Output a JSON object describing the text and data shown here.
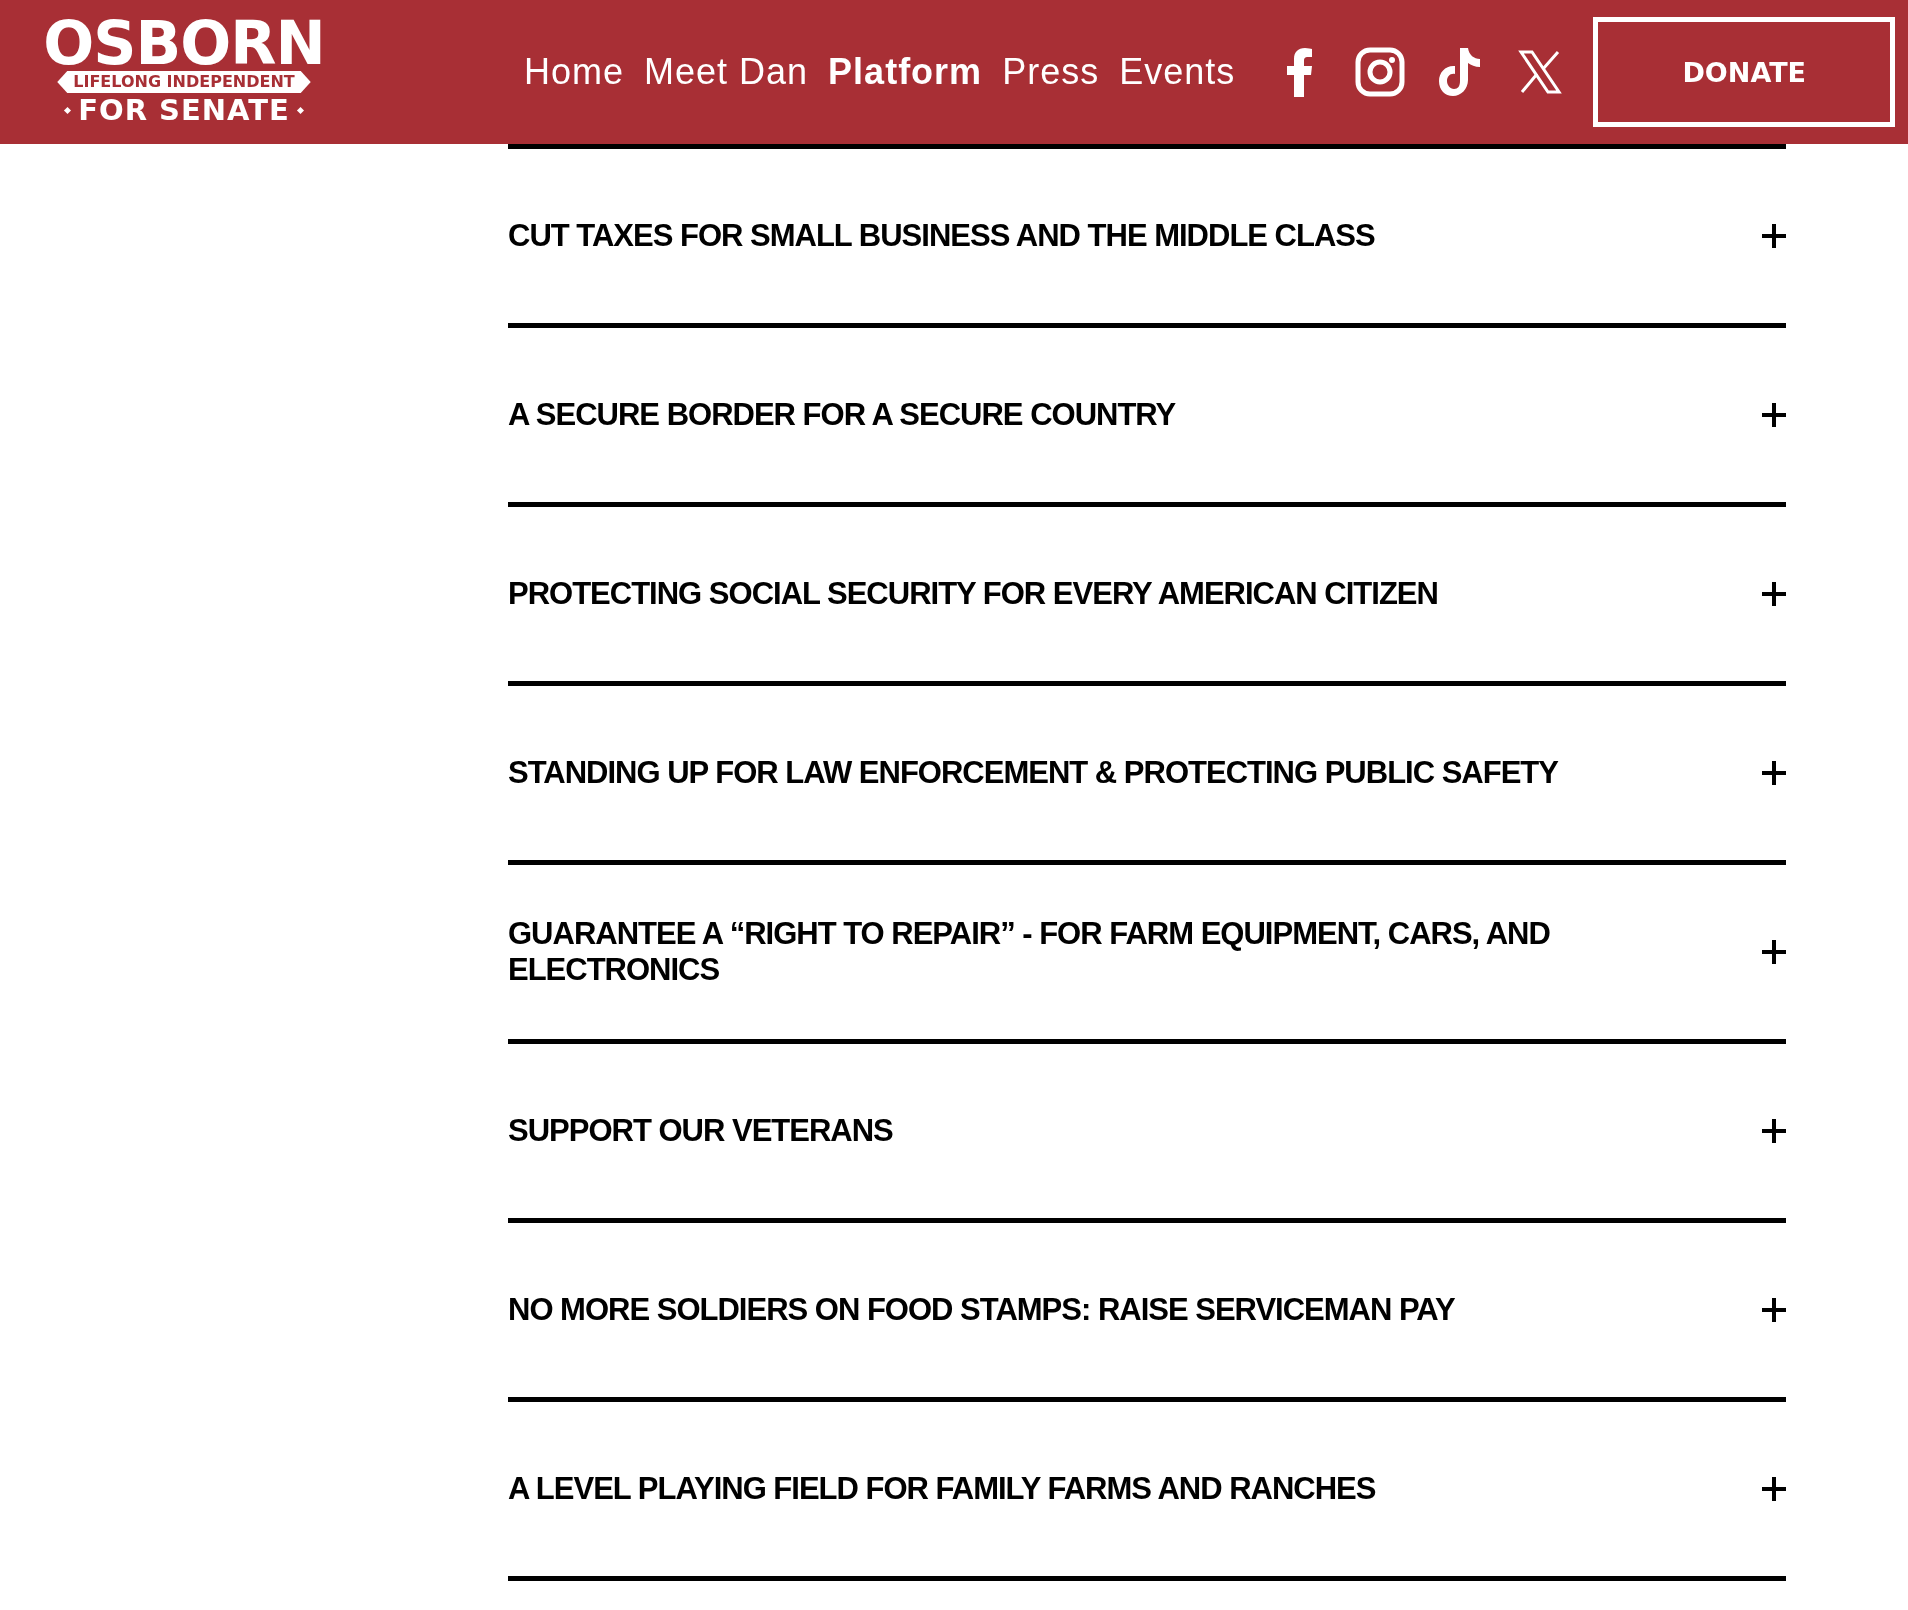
{
  "logo": {
    "name": "OSBORN",
    "tagline": "LIFELONG INDEPENDENT",
    "office": "FOR SENATE"
  },
  "nav": [
    {
      "label": "Home",
      "selected": false
    },
    {
      "label": "Meet Dan",
      "selected": false
    },
    {
      "label": "Platform",
      "selected": true
    },
    {
      "label": "Press",
      "selected": false
    },
    {
      "label": "Events",
      "selected": false
    }
  ],
  "social": [
    {
      "kind": "facebook"
    },
    {
      "kind": "instagram"
    },
    {
      "kind": "tiktok"
    },
    {
      "kind": "x"
    }
  ],
  "donate_button": "DONATE",
  "platform": [
    {
      "title": "CUT TAXES FOR SMALL BUSINESS AND THE MIDDLE CLASS",
      "expanded": false
    },
    {
      "title": "A SECURE BORDER FOR A SECURE COUNTRY",
      "expanded": false
    },
    {
      "title": "PROTECTING SOCIAL SECURITY FOR EVERY AMERICAN CITIZEN",
      "expanded": false
    },
    {
      "title": "STANDING UP FOR LAW ENFORCEMENT & PROTECTING PUBLIC SAFETY",
      "expanded": false
    },
    {
      "title": "GUARANTEE A “RIGHT TO REPAIR” - FOR FARM EQUIPMENT, CARS, AND ELECTRONICS",
      "expanded": false
    },
    {
      "title": "SUPPORT OUR VETERANS",
      "expanded": false
    },
    {
      "title": "NO MORE SOLDIERS ON FOOD STAMPS: RAISE SERVICEMAN PAY",
      "expanded": false
    },
    {
      "title": "A LEVEL PLAYING FIELD FOR FAMILY FARMS AND RANCHES",
      "expanded": false
    }
  ]
}
